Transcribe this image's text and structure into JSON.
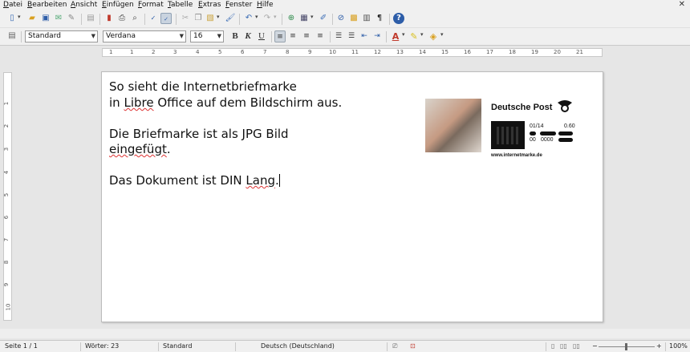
{
  "menu": [
    "Datei",
    "Bearbeiten",
    "Ansicht",
    "Einfügen",
    "Format",
    "Tabelle",
    "Extras",
    "Fenster",
    "Hilfe"
  ],
  "toolbar2": {
    "paragraph_style": "Standard",
    "font_name": "Verdana",
    "font_size": "16",
    "bold": "B",
    "italic": "K",
    "underline": "U"
  },
  "ruler_h": [
    "1",
    "1",
    "2",
    "3",
    "4",
    "5",
    "6",
    "7",
    "8",
    "9",
    "10",
    "11",
    "12",
    "13",
    "14",
    "15",
    "16",
    "17",
    "18",
    "19",
    "20",
    "21"
  ],
  "ruler_v": [
    "1",
    "2",
    "3",
    "4",
    "5",
    "6",
    "7",
    "8",
    "9",
    "10"
  ],
  "document": {
    "line1": "So sieht die Internetbriefmarke",
    "line2_a": "in",
    "line2_b": "Libre",
    "line2_c": "Office auf dem Bildschirm aus.",
    "line3": "Die Briefmarke ist als JPG Bild",
    "line4_a": "eingefügt",
    "line4_b": ".",
    "line5_a": "Das Dokument ist DIN",
    "line5_b": "Lang",
    "line5_c": "."
  },
  "stamp": {
    "brand": "Deutsche Post",
    "date": "01/14",
    "value": "0.60",
    "code_a": "00",
    "code_b": "0000",
    "url": "www.internetmarke.de"
  },
  "status": {
    "page": "Seite 1 / 1",
    "words": "Wörter: 23",
    "style": "Standard",
    "language": "Deutsch (Deutschland)",
    "zoom_minus": "−",
    "zoom_plus": "+",
    "zoom": "100%"
  }
}
